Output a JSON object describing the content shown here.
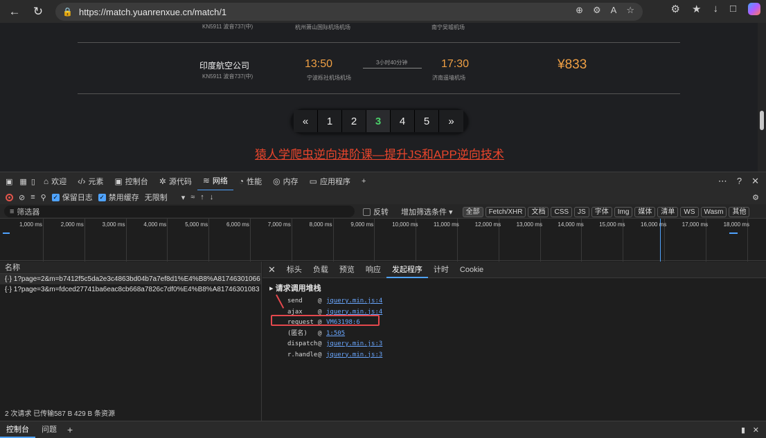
{
  "browser": {
    "url": "https://match.yuanrenxue.cn/match/1"
  },
  "page": {
    "flight_top": {
      "flight_no": "KN5911 波音737(中)",
      "dep_airport": "杭州萧山国际机场机场",
      "arr_airport": "南宁吴墟机场"
    },
    "flight_main": {
      "airline": "印度航空公司",
      "flight_no": "KN5911 波音737(中)",
      "dep_time": "13:50",
      "dep_airport": "宁波栎社机场机场",
      "duration": "3小时40分钟",
      "arr_time": "17:30",
      "arr_airport": "济南遥墙机场",
      "price": "¥833"
    },
    "pager": [
      "«",
      "1",
      "2",
      "3",
      "4",
      "5",
      "»"
    ],
    "pager_active": "3",
    "promo": "猿人学爬虫逆向进阶课—提升JS和APP逆向技术"
  },
  "devtools": {
    "tabs": [
      "欢迎",
      "元素",
      "控制台",
      "源代码",
      "网络",
      "性能",
      "内存",
      "应用程序"
    ],
    "active_tab": "网络",
    "toolbar": {
      "preserve_log": "保留日志",
      "disable_cache": "禁用缓存",
      "throttle": "无限制"
    },
    "filter": {
      "placeholder": "筛选器",
      "invert": "反转",
      "more_filters": "增加筛选条件",
      "chips": [
        "全部",
        "Fetch/XHR",
        "文档",
        "CSS",
        "JS",
        "字体",
        "Img",
        "媒体",
        "清单",
        "WS",
        "Wasm",
        "其他"
      ]
    },
    "timeline_ticks": [
      "1,000 ms",
      "2,000 ms",
      "3,000 ms",
      "4,000 ms",
      "5,000 ms",
      "6,000 ms",
      "7,000 ms",
      "8,000 ms",
      "9,000 ms",
      "10,000 ms",
      "11,000 ms",
      "12,000 ms",
      "13,000 ms",
      "14,000 ms",
      "15,000 ms",
      "16,000 ms",
      "17,000 ms",
      "18,000 ms"
    ],
    "requests_header": "名称",
    "requests": [
      "1?page=2&m=b7412f5c5da2e3c4863bd04b7a7ef8d1%E4%B8%A81746301066",
      "1?page=3&m=fdced27741ba6eac8cb668a7826c7df0%E4%B8%A81746301083"
    ],
    "status": "2 次请求   已传输587 B   429 B 条资源",
    "detail_tabs": [
      "标头",
      "负载",
      "预览",
      "响应",
      "发起程序",
      "计时",
      "Cookie"
    ],
    "detail_active": "发起程序",
    "stack_title": "请求调用堆栈",
    "stack": [
      {
        "fn": "send",
        "src": "jquery.min.js:4"
      },
      {
        "fn": "ajax",
        "src": "jquery.min.js:4"
      },
      {
        "fn": "request",
        "src": "VM63198:6"
      },
      {
        "fn": "(匿名)",
        "src": "1:505"
      },
      {
        "fn": "dispatch",
        "src": "jquery.min.js:3"
      },
      {
        "fn": "r.handle",
        "src": "jquery.min.js:3"
      }
    ],
    "bottom_tabs": [
      "控制台",
      "问题"
    ]
  }
}
